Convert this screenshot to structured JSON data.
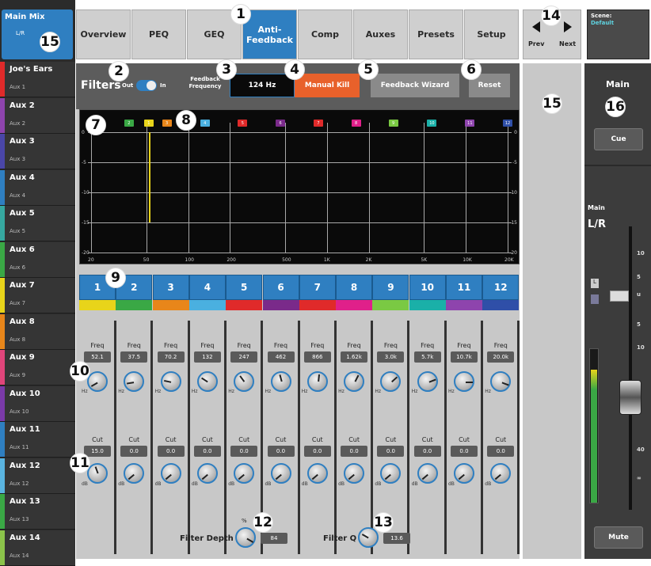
{
  "sidebar": {
    "main_mix": {
      "title": "Main Mix",
      "sub": "L/R"
    },
    "auxes": [
      {
        "name": "Joe's Ears",
        "sub": "Aux 1",
        "color": "#e02a2a"
      },
      {
        "name": "Aux 2",
        "sub": "Aux 2",
        "color": "#8e44ad"
      },
      {
        "name": "Aux 3",
        "sub": "Aux 3",
        "color": "#4a46a8"
      },
      {
        "name": "Aux 4",
        "sub": "Aux 4",
        "color": "#2f7fc1"
      },
      {
        "name": "Aux 5",
        "sub": "Aux 5",
        "color": "#36a8a0"
      },
      {
        "name": "Aux 6",
        "sub": "Aux 6",
        "color": "#3aa845"
      },
      {
        "name": "Aux 7",
        "sub": "Aux 7",
        "color": "#e8d41a"
      },
      {
        "name": "Aux 8",
        "sub": "Aux 8",
        "color": "#e8861a"
      },
      {
        "name": "Aux 9",
        "sub": "Aux 9",
        "color": "#e0457a"
      },
      {
        "name": "Aux 10",
        "sub": "Aux 10",
        "color": "#7a3aa8"
      },
      {
        "name": "Aux 11",
        "sub": "Aux 11",
        "color": "#2f7fc1"
      },
      {
        "name": "Aux 12",
        "sub": "Aux 12",
        "color": "#5ab4e0"
      },
      {
        "name": "Aux 13",
        "sub": "Aux 13",
        "color": "#3aa845"
      },
      {
        "name": "Aux 14",
        "sub": "Aux 14",
        "color": "#8bc34a"
      }
    ]
  },
  "tabs": [
    {
      "label": "Overview"
    },
    {
      "label": "PEQ"
    },
    {
      "label": "GEQ"
    },
    {
      "label": "Anti-\nFeedback",
      "active": true
    },
    {
      "label": "Comp"
    },
    {
      "label": "Auxes"
    },
    {
      "label": "Presets"
    },
    {
      "label": "Setup"
    }
  ],
  "nav": {
    "prev": "Prev",
    "next": "Next"
  },
  "scene": {
    "label": "Scene:",
    "name": "Default"
  },
  "filters": {
    "title": "Filters",
    "out_label": "Out",
    "in_label": "In",
    "feedback_label": "Feedback\nFrequency",
    "frequency": "124 Hz",
    "manual_kill": "Manual Kill",
    "wizard": "Feedback Wizard",
    "reset": "Reset"
  },
  "graph": {
    "y_ticks": [
      "0",
      "-5",
      "-10",
      "-15",
      "-20"
    ],
    "x_ticks": [
      "20",
      "50",
      "100",
      "200",
      "500",
      "1K",
      "2K",
      "5K",
      "10K",
      "20K"
    ],
    "marker_freq_hz": 52.1,
    "marker_cut_db": 15.0
  },
  "filter_bands": [
    {
      "num": "1",
      "color": "#e8d41a",
      "freq": "52.1",
      "cut": "15.0"
    },
    {
      "num": "2",
      "color": "#3aa845",
      "freq": "37.5",
      "cut": "0.0"
    },
    {
      "num": "3",
      "color": "#e8861a",
      "freq": "70.2",
      "cut": "0.0"
    },
    {
      "num": "4",
      "color": "#4ab0e0",
      "freq": "132",
      "cut": "0.0"
    },
    {
      "num": "5",
      "color": "#e02a2a",
      "freq": "247",
      "cut": "0.0"
    },
    {
      "num": "6",
      "color": "#7a2a8a",
      "freq": "462",
      "cut": "0.0"
    },
    {
      "num": "7",
      "color": "#e02a2a",
      "freq": "866",
      "cut": "0.0"
    },
    {
      "num": "8",
      "color": "#e0208a",
      "freq": "1.62k",
      "cut": "0.0"
    },
    {
      "num": "9",
      "color": "#7ac943",
      "freq": "3.0k",
      "cut": "0.0"
    },
    {
      "num": "10",
      "color": "#1ab0a8",
      "freq": "5.7k",
      "cut": "0.0"
    },
    {
      "num": "11",
      "color": "#8e44ad",
      "freq": "10.7k",
      "cut": "0.0"
    },
    {
      "num": "12",
      "color": "#2f4fa8",
      "freq": "20.0k",
      "cut": "0.0"
    }
  ],
  "knob_labels": {
    "freq": "Freq",
    "cut": "Cut",
    "hz": "Hz",
    "db": "dB"
  },
  "depth": {
    "label": "Filter Depth",
    "unit": "%",
    "value": "84"
  },
  "q": {
    "label": "Filter Q",
    "value": "13.6"
  },
  "right_panel": {
    "title": "Main",
    "cue": "Cue",
    "fader_title": "Main",
    "fader_sub": "L/R",
    "scale": [
      "10",
      "5",
      "u",
      "5",
      "10",
      "40",
      "∞"
    ],
    "l_label": "L",
    "mute": "Mute"
  },
  "callouts": [
    "1",
    "2",
    "3",
    "4",
    "5",
    "6",
    "7",
    "8",
    "9",
    "10",
    "11",
    "12",
    "13",
    "14",
    "15",
    "15",
    "16"
  ]
}
